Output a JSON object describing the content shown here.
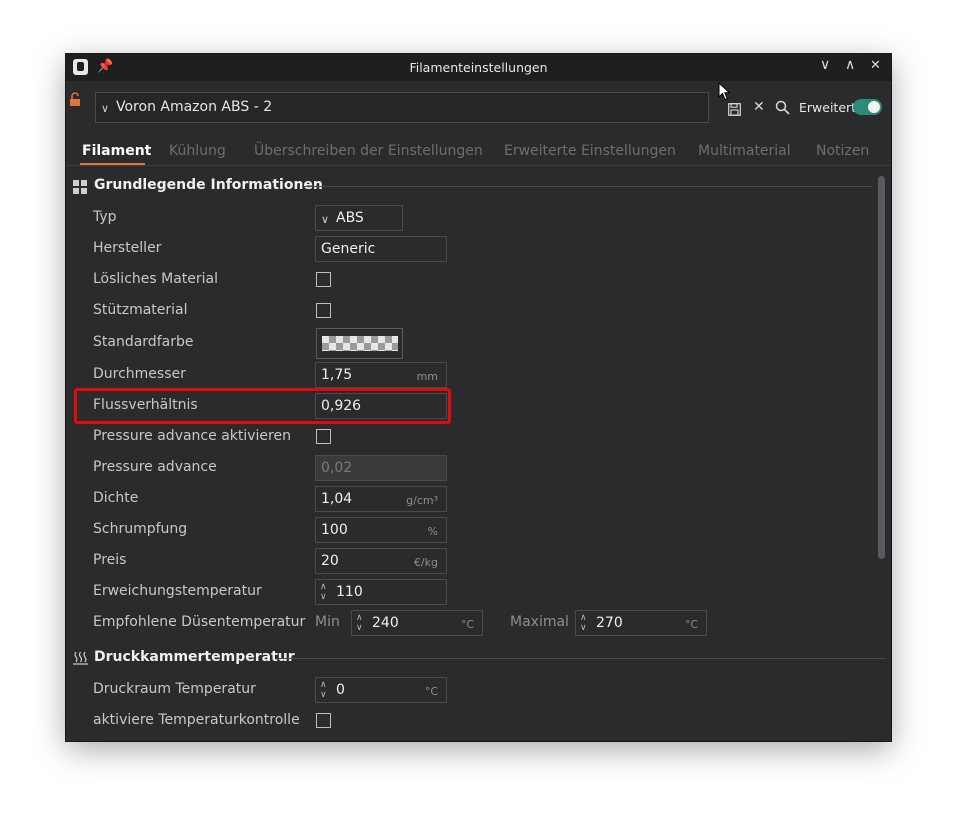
{
  "window": {
    "title": "Filamenteinstellungen"
  },
  "toolbar": {
    "preset": "Voron Amazon ABS - 2",
    "mode_label": "Erweitert",
    "mode_enabled": true
  },
  "tabs": [
    {
      "label": "Filament",
      "active": true
    },
    {
      "label": "Kühlung",
      "active": false
    },
    {
      "label": "Überschreiben der Einstellungen",
      "active": false
    },
    {
      "label": "Erweiterte Einstellungen",
      "active": false
    },
    {
      "label": "Multimaterial",
      "active": false
    },
    {
      "label": "Notizen",
      "active": false
    }
  ],
  "basic": {
    "title": "Grundlegende Informationen",
    "type": {
      "label": "Typ",
      "value": "ABS"
    },
    "vendor": {
      "label": "Hersteller",
      "value": "Generic"
    },
    "soluble": {
      "label": "Lösliches Material",
      "checked": false
    },
    "support": {
      "label": "Stützmaterial",
      "checked": false
    },
    "color": {
      "label": "Standardfarbe"
    },
    "diameter": {
      "label": "Durchmesser",
      "value": "1,75",
      "unit": "mm"
    },
    "flow": {
      "label": "Flussverhältnis",
      "value": "0,926"
    },
    "pa_enable": {
      "label": "Pressure advance aktivieren",
      "checked": false
    },
    "pa": {
      "label": "Pressure advance",
      "value": "0,02"
    },
    "density": {
      "label": "Dichte",
      "value": "1,04",
      "unit": "g/cm³"
    },
    "shrink": {
      "label": "Schrumpfung",
      "value": "100",
      "unit": "%"
    },
    "price": {
      "label": "Preis",
      "value": "20",
      "unit": "€/kg"
    },
    "softening": {
      "label": "Erweichungstemperatur",
      "value": "110"
    },
    "nozzle": {
      "label": "Empfohlene Düsentemperatur",
      "min_label": "Min",
      "min_value": "240",
      "max_label": "Maximal",
      "max_value": "270",
      "unit": "°C"
    }
  },
  "chamber": {
    "title": "Druckkammertemperatur",
    "temp": {
      "label": "Druckraum Temperatur",
      "value": "0",
      "unit": "°C"
    },
    "control": {
      "label": "aktiviere Temperaturkontrolle",
      "checked": false
    }
  }
}
